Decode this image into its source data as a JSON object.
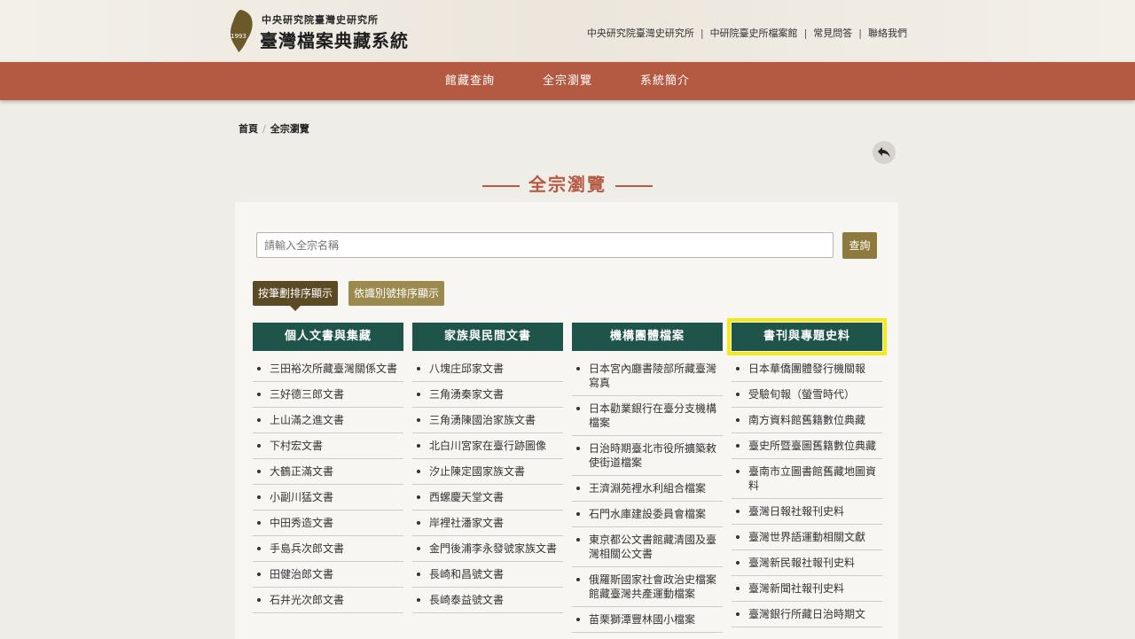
{
  "header": {
    "logo_line1": "中央研究院臺灣史研究所",
    "logo_line2": "臺灣檔案典藏系統",
    "logo_year": "1993",
    "top_links": [
      "中央研究院臺灣史研究所",
      "中研院臺史所檔案館",
      "常見問答",
      "聯絡我們"
    ]
  },
  "nav": {
    "items": [
      "館藏查詢",
      "全宗瀏覽",
      "系統簡介"
    ]
  },
  "breadcrumb": {
    "home": "首頁",
    "current": "全宗瀏覽"
  },
  "page_title": "全宗瀏覽",
  "search": {
    "placeholder": "請輸入全宗名稱",
    "button": "查詢"
  },
  "sort": {
    "by_stroke": "按筆劃排序顯示",
    "by_id": "依識別號排序顯示"
  },
  "columns": [
    {
      "title": "個人文書與集藏",
      "items": [
        "三田裕次所藏臺灣關係文書",
        "三好德三郎文書",
        "上山滿之進文書",
        "下村宏文書",
        "大鶴正滿文書",
        "小副川猛文書",
        "中田秀造文書",
        "手島兵次郎文書",
        "田健治郎文書",
        "石井光次郎文書"
      ]
    },
    {
      "title": "家族與民間文書",
      "items": [
        "八塊庄邱家文書",
        "三角湧秦家文書",
        "三角湧陳國治家族文書",
        "北白川宮家在臺行跡圖像",
        "汐止陳定國家族文書",
        "西螺慶天堂文書",
        "岸裡社潘家文書",
        "金門後浦李永發號家族文書",
        "長崎和昌號文書",
        "長崎泰益號文書"
      ]
    },
    {
      "title": "機構團體檔案",
      "items": [
        "日本宮內廳書陵部所藏臺灣寫真",
        "日本勸業銀行在臺分支機構檔案",
        "日治時期臺北市役所擴築敕使街道檔案",
        "王濟淵苑裡水利組合檔案",
        "石門水庫建設委員會檔案",
        "東京都公文書館藏清國及臺灣相關公文書",
        "俄羅斯國家社會政治史檔案館藏臺灣共產運動檔案",
        "苗栗獅潭豐林國小檔案"
      ]
    },
    {
      "title": "書刊與專題史料",
      "items": [
        "日本華僑團體發行機關報",
        "受驗旬報（螢雪時代）",
        "南方資料館舊籍數位典藏",
        "臺史所暨臺圖舊籍數位典藏",
        "臺南市立圖書館舊藏地圖資料",
        "臺灣日報社報刊史料",
        "臺灣世界語運動相關文獻",
        "臺灣新民報社報刊史料",
        "臺灣新聞社報刊史料",
        "臺灣銀行所藏日治時期文"
      ]
    }
  ],
  "colors": {
    "nav_bg": "#b55a42",
    "header_col_bg": "#1e5449",
    "search_btn": "#8e7a3c",
    "highlight": "#f5ea16"
  }
}
